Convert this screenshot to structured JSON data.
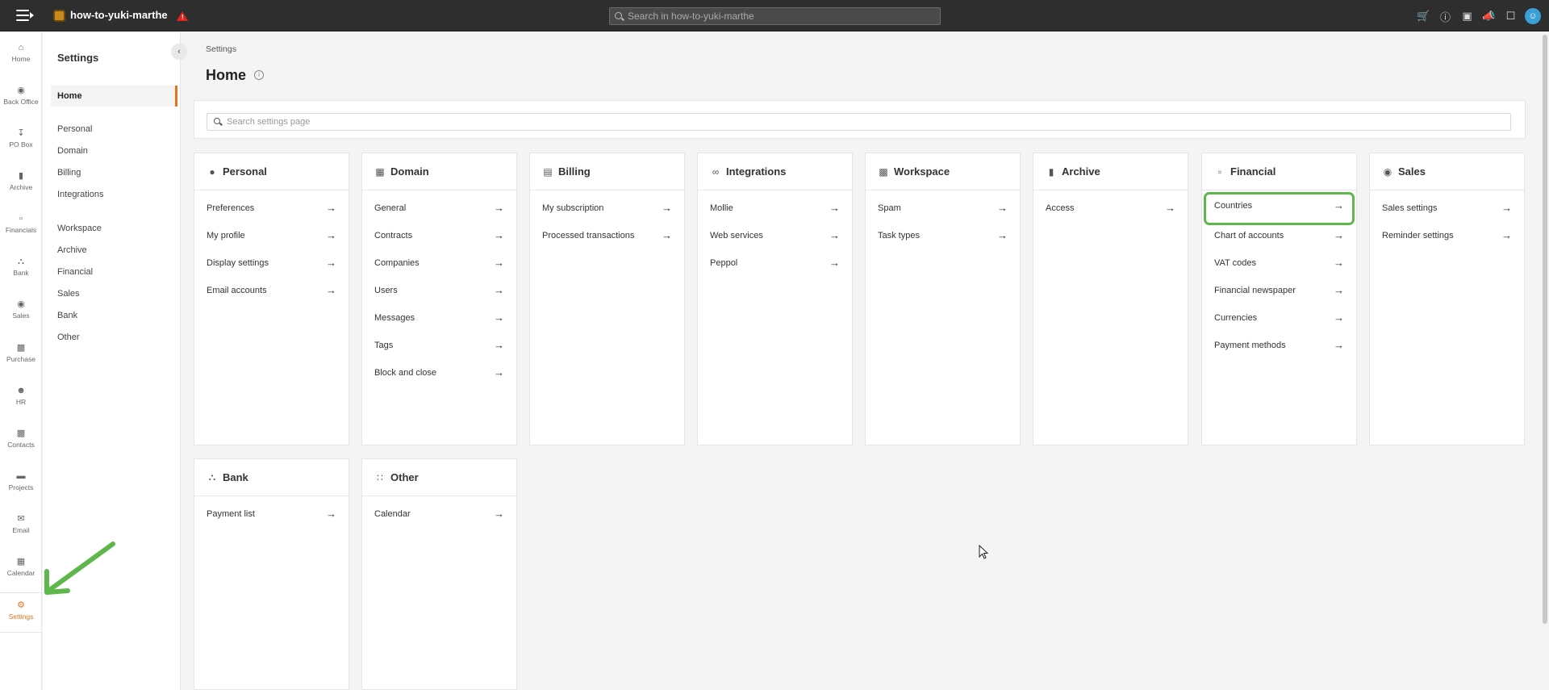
{
  "topbar": {
    "brand": "how-to-yuki-marthe",
    "search_placeholder": "Search in how-to-yuki-marthe",
    "icons": [
      "menu-icon",
      "cart-icon",
      "info-icon",
      "store-icon",
      "megaphone-icon",
      "bookmark-icon",
      "user-icon"
    ]
  },
  "rail": [
    {
      "label": "Home",
      "icon": "home-icon"
    },
    {
      "label": "Back Office",
      "icon": "back-office-icon"
    },
    {
      "label": "PO Box",
      "icon": "inbox-icon"
    },
    {
      "label": "Archive",
      "icon": "archive-icon"
    },
    {
      "label": "Financials",
      "icon": "bar-chart-icon"
    },
    {
      "label": "Bank",
      "icon": "bank-icon"
    },
    {
      "label": "Sales",
      "icon": "handshake-icon"
    },
    {
      "label": "Purchase",
      "icon": "truck-icon"
    },
    {
      "label": "HR",
      "icon": "people-icon"
    },
    {
      "label": "Contacts",
      "icon": "contacts-icon"
    },
    {
      "label": "Projects",
      "icon": "folder-icon"
    },
    {
      "label": "Email",
      "icon": "envelope-icon"
    },
    {
      "label": "Calendar",
      "icon": "calendar-icon"
    },
    {
      "label": "Settings",
      "icon": "settings-icon"
    }
  ],
  "subnav": {
    "title": "Settings",
    "home": "Home",
    "group1": [
      "Personal",
      "Domain",
      "Billing",
      "Integrations"
    ],
    "group2": [
      "Workspace",
      "Archive",
      "Financial",
      "Sales",
      "Bank",
      "Other"
    ]
  },
  "main": {
    "breadcrumb": "Settings",
    "title": "Home",
    "search_placeholder": "Search settings page"
  },
  "cards": [
    {
      "title": "Personal",
      "icon": "person-icon",
      "items": [
        "Preferences",
        "My profile",
        "Display settings",
        "Email accounts"
      ]
    },
    {
      "title": "Domain",
      "icon": "building-icon",
      "items": [
        "General",
        "Contracts",
        "Companies",
        "Users",
        "Messages",
        "Tags",
        "Block and close"
      ]
    },
    {
      "title": "Billing",
      "icon": "billing-icon",
      "items": [
        "My subscription",
        "Processed transactions"
      ]
    },
    {
      "title": "Integrations",
      "icon": "link-icon",
      "items": [
        "Mollie",
        "Web services",
        "Peppol"
      ]
    },
    {
      "title": "Workspace",
      "icon": "workspace-icon",
      "items": [
        "Spam",
        "Task types"
      ]
    },
    {
      "title": "Archive",
      "icon": "archive-icon",
      "items": [
        "Access"
      ]
    },
    {
      "title": "Financial",
      "icon": "bar-chart-icon",
      "items": [
        "Countries",
        "Chart of accounts",
        "VAT codes",
        "Financial newspaper",
        "Currencies",
        "Payment methods"
      ]
    },
    {
      "title": "Sales",
      "icon": "handshake-icon",
      "items": [
        "Sales settings",
        "Reminder settings"
      ]
    },
    {
      "title": "Bank",
      "icon": "bank-icon",
      "items": [
        "Payment list"
      ]
    },
    {
      "title": "Other",
      "icon": "grid-icon",
      "items": [
        "Calendar"
      ]
    }
  ],
  "colors": {
    "accent": "#e8731e",
    "highlight": "#5db74a",
    "topbar": "#2e2e2e"
  }
}
